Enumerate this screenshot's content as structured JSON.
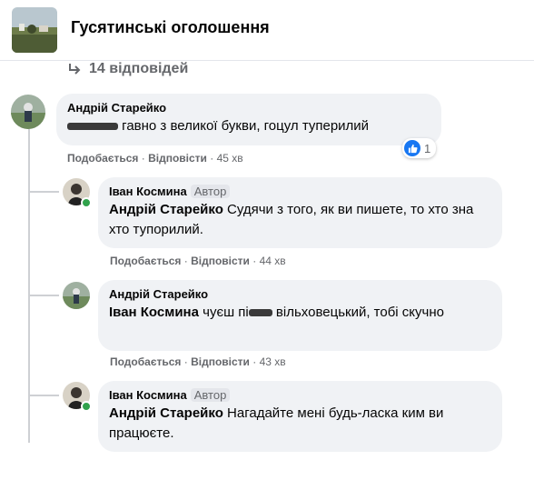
{
  "group": {
    "title": "Гусятинські оголошення"
  },
  "replies_label": "14 відповідей",
  "comments": [
    {
      "author": "Андрій Старейко",
      "text_after": "гавно з великої букви, гоцул туперилий",
      "reactions_count": "1",
      "like": "Подобається",
      "reply": "Відповісти",
      "time": "45 хв"
    },
    {
      "author": "Іван Космина",
      "badge": "Автор",
      "mention": "Андрій Старейко",
      "text": "Судячи з того, як ви пишете, то хто зна хто тупорилий.",
      "like": "Подобається",
      "reply": "Відповісти",
      "time": "44 хв"
    },
    {
      "author": "Андрій Старейко",
      "mention": "Іван Космина",
      "text_before": "чуєш пі",
      "text_after": "вільховецький, тобі скучно",
      "like": "Подобається",
      "reply": "Відповісти",
      "time": "43 хв"
    },
    {
      "author": "Іван Космина",
      "badge": "Автор",
      "mention": "Андрій Старейко",
      "text": "Нагадайте мені будь-ласка ким ви працюєте."
    }
  ],
  "separator": "·",
  "colors": {
    "bubble": "#f0f2f5",
    "meta": "#65676b",
    "like_blue": "#1877f2",
    "online": "#31a24c"
  }
}
